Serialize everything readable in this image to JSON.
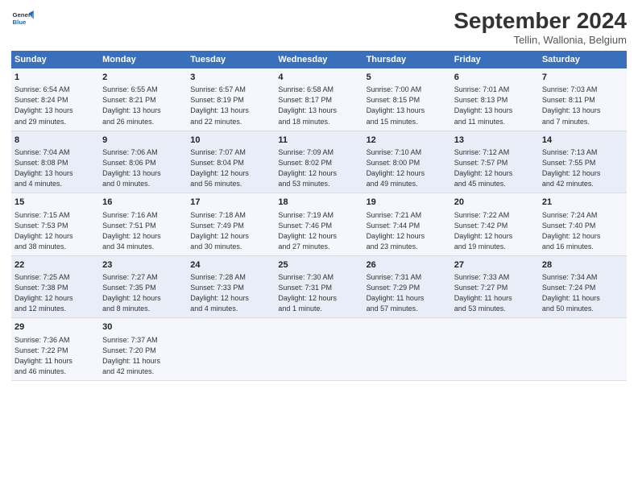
{
  "header": {
    "logo_line1": "General",
    "logo_line2": "Blue",
    "title": "September 2024",
    "subtitle": "Tellin, Wallonia, Belgium"
  },
  "days_of_week": [
    "Sunday",
    "Monday",
    "Tuesday",
    "Wednesday",
    "Thursday",
    "Friday",
    "Saturday"
  ],
  "weeks": [
    [
      {
        "num": "1",
        "info": "Sunrise: 6:54 AM\nSunset: 8:24 PM\nDaylight: 13 hours\nand 29 minutes."
      },
      {
        "num": "2",
        "info": "Sunrise: 6:55 AM\nSunset: 8:21 PM\nDaylight: 13 hours\nand 26 minutes."
      },
      {
        "num": "3",
        "info": "Sunrise: 6:57 AM\nSunset: 8:19 PM\nDaylight: 13 hours\nand 22 minutes."
      },
      {
        "num": "4",
        "info": "Sunrise: 6:58 AM\nSunset: 8:17 PM\nDaylight: 13 hours\nand 18 minutes."
      },
      {
        "num": "5",
        "info": "Sunrise: 7:00 AM\nSunset: 8:15 PM\nDaylight: 13 hours\nand 15 minutes."
      },
      {
        "num": "6",
        "info": "Sunrise: 7:01 AM\nSunset: 8:13 PM\nDaylight: 13 hours\nand 11 minutes."
      },
      {
        "num": "7",
        "info": "Sunrise: 7:03 AM\nSunset: 8:11 PM\nDaylight: 13 hours\nand 7 minutes."
      }
    ],
    [
      {
        "num": "8",
        "info": "Sunrise: 7:04 AM\nSunset: 8:08 PM\nDaylight: 13 hours\nand 4 minutes."
      },
      {
        "num": "9",
        "info": "Sunrise: 7:06 AM\nSunset: 8:06 PM\nDaylight: 13 hours\nand 0 minutes."
      },
      {
        "num": "10",
        "info": "Sunrise: 7:07 AM\nSunset: 8:04 PM\nDaylight: 12 hours\nand 56 minutes."
      },
      {
        "num": "11",
        "info": "Sunrise: 7:09 AM\nSunset: 8:02 PM\nDaylight: 12 hours\nand 53 minutes."
      },
      {
        "num": "12",
        "info": "Sunrise: 7:10 AM\nSunset: 8:00 PM\nDaylight: 12 hours\nand 49 minutes."
      },
      {
        "num": "13",
        "info": "Sunrise: 7:12 AM\nSunset: 7:57 PM\nDaylight: 12 hours\nand 45 minutes."
      },
      {
        "num": "14",
        "info": "Sunrise: 7:13 AM\nSunset: 7:55 PM\nDaylight: 12 hours\nand 42 minutes."
      }
    ],
    [
      {
        "num": "15",
        "info": "Sunrise: 7:15 AM\nSunset: 7:53 PM\nDaylight: 12 hours\nand 38 minutes."
      },
      {
        "num": "16",
        "info": "Sunrise: 7:16 AM\nSunset: 7:51 PM\nDaylight: 12 hours\nand 34 minutes."
      },
      {
        "num": "17",
        "info": "Sunrise: 7:18 AM\nSunset: 7:49 PM\nDaylight: 12 hours\nand 30 minutes."
      },
      {
        "num": "18",
        "info": "Sunrise: 7:19 AM\nSunset: 7:46 PM\nDaylight: 12 hours\nand 27 minutes."
      },
      {
        "num": "19",
        "info": "Sunrise: 7:21 AM\nSunset: 7:44 PM\nDaylight: 12 hours\nand 23 minutes."
      },
      {
        "num": "20",
        "info": "Sunrise: 7:22 AM\nSunset: 7:42 PM\nDaylight: 12 hours\nand 19 minutes."
      },
      {
        "num": "21",
        "info": "Sunrise: 7:24 AM\nSunset: 7:40 PM\nDaylight: 12 hours\nand 16 minutes."
      }
    ],
    [
      {
        "num": "22",
        "info": "Sunrise: 7:25 AM\nSunset: 7:38 PM\nDaylight: 12 hours\nand 12 minutes."
      },
      {
        "num": "23",
        "info": "Sunrise: 7:27 AM\nSunset: 7:35 PM\nDaylight: 12 hours\nand 8 minutes."
      },
      {
        "num": "24",
        "info": "Sunrise: 7:28 AM\nSunset: 7:33 PM\nDaylight: 12 hours\nand 4 minutes."
      },
      {
        "num": "25",
        "info": "Sunrise: 7:30 AM\nSunset: 7:31 PM\nDaylight: 12 hours\nand 1 minute."
      },
      {
        "num": "26",
        "info": "Sunrise: 7:31 AM\nSunset: 7:29 PM\nDaylight: 11 hours\nand 57 minutes."
      },
      {
        "num": "27",
        "info": "Sunrise: 7:33 AM\nSunset: 7:27 PM\nDaylight: 11 hours\nand 53 minutes."
      },
      {
        "num": "28",
        "info": "Sunrise: 7:34 AM\nSunset: 7:24 PM\nDaylight: 11 hours\nand 50 minutes."
      }
    ],
    [
      {
        "num": "29",
        "info": "Sunrise: 7:36 AM\nSunset: 7:22 PM\nDaylight: 11 hours\nand 46 minutes."
      },
      {
        "num": "30",
        "info": "Sunrise: 7:37 AM\nSunset: 7:20 PM\nDaylight: 11 hours\nand 42 minutes."
      },
      {
        "num": "",
        "info": ""
      },
      {
        "num": "",
        "info": ""
      },
      {
        "num": "",
        "info": ""
      },
      {
        "num": "",
        "info": ""
      },
      {
        "num": "",
        "info": ""
      }
    ]
  ]
}
